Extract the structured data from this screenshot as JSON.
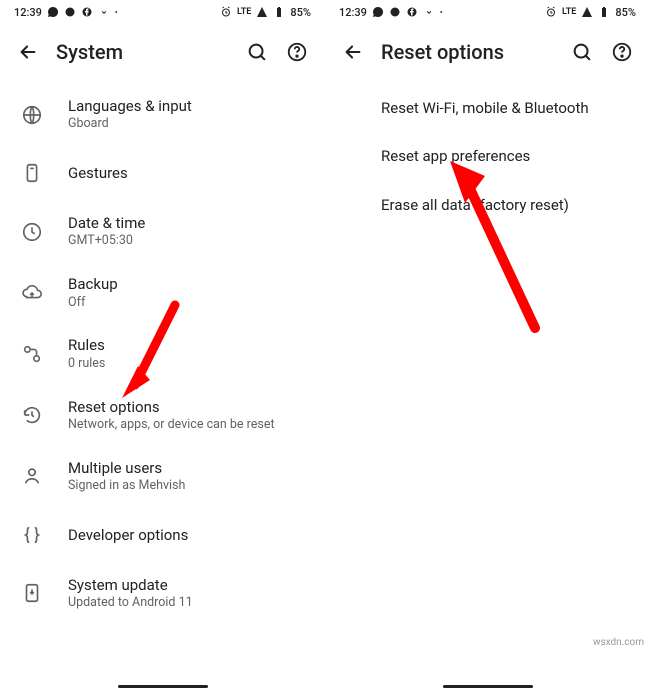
{
  "status": {
    "time": "12:39",
    "network_label": "LTE",
    "battery": "85%"
  },
  "left": {
    "title": "System",
    "items": [
      {
        "icon": "globe",
        "title": "Languages & input",
        "sub": "Gboard"
      },
      {
        "icon": "gesture",
        "title": "Gestures",
        "sub": ""
      },
      {
        "icon": "clock",
        "title": "Date & time",
        "sub": "GMT+05:30"
      },
      {
        "icon": "cloud-upload",
        "title": "Backup",
        "sub": "Off"
      },
      {
        "icon": "rules",
        "title": "Rules",
        "sub": "0 rules"
      },
      {
        "icon": "history",
        "title": "Reset options",
        "sub": "Network, apps, or device can be reset"
      },
      {
        "icon": "user",
        "title": "Multiple users",
        "sub": "Signed in as Mehvish"
      },
      {
        "icon": "braces",
        "title": "Developer options",
        "sub": ""
      },
      {
        "icon": "system-update",
        "title": "System update",
        "sub": "Updated to Android 11"
      }
    ]
  },
  "right": {
    "title": "Reset options",
    "items": [
      {
        "title": "Reset Wi-Fi, mobile & Bluetooth"
      },
      {
        "title": "Reset app preferences"
      },
      {
        "title": "Erase all data (factory reset)"
      }
    ]
  },
  "watermark": "wsxdn.com"
}
